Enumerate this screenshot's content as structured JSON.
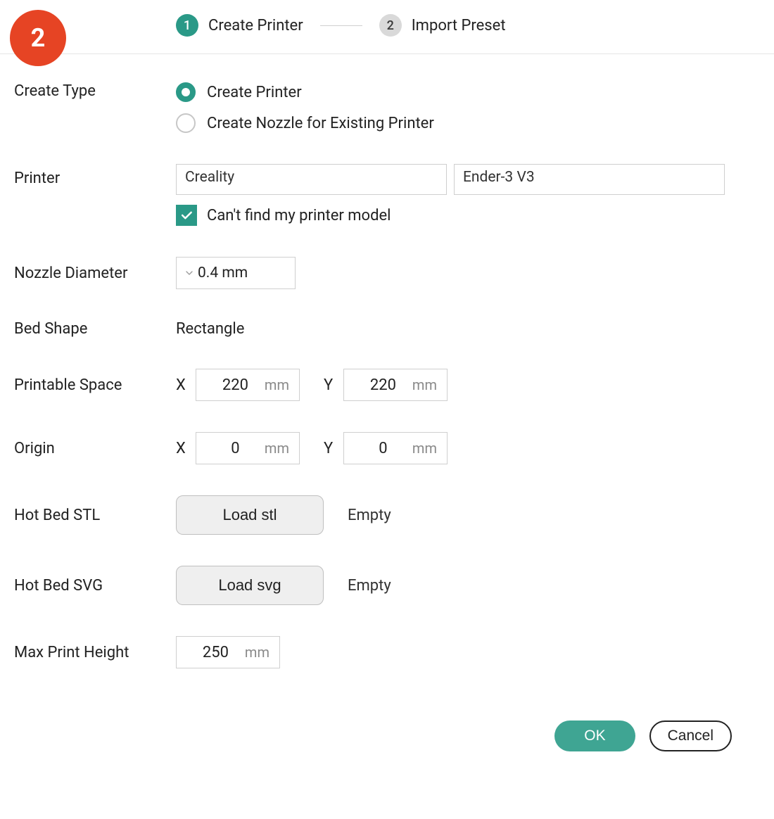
{
  "page_badge": "2",
  "stepper": {
    "step1": {
      "num": "1",
      "label": "Create Printer"
    },
    "step2": {
      "num": "2",
      "label": "Import Preset"
    }
  },
  "create_type": {
    "label": "Create Type",
    "option_printer": "Create Printer",
    "option_nozzle": "Create Nozzle for Existing Printer"
  },
  "printer": {
    "label": "Printer",
    "brand": "Creality",
    "model": "Ender-3 V3",
    "cant_find": "Can't find my printer model"
  },
  "nozzle": {
    "label": "Nozzle Diameter",
    "value": "0.4 mm"
  },
  "bed_shape": {
    "label": "Bed Shape",
    "value": "Rectangle"
  },
  "printable_space": {
    "label": "Printable Space",
    "x_label": "X",
    "x_value": "220",
    "x_unit": "mm",
    "y_label": "Y",
    "y_value": "220",
    "y_unit": "mm"
  },
  "origin": {
    "label": "Origin",
    "x_label": "X",
    "x_value": "0",
    "x_unit": "mm",
    "y_label": "Y",
    "y_value": "0",
    "y_unit": "mm"
  },
  "hot_bed_stl": {
    "label": "Hot Bed STL",
    "button": "Load stl",
    "status": "Empty"
  },
  "hot_bed_svg": {
    "label": "Hot Bed SVG",
    "button": "Load svg",
    "status": "Empty"
  },
  "max_height": {
    "label": "Max Print Height",
    "value": "250",
    "unit": "mm"
  },
  "footer": {
    "ok": "OK",
    "cancel": "Cancel"
  }
}
